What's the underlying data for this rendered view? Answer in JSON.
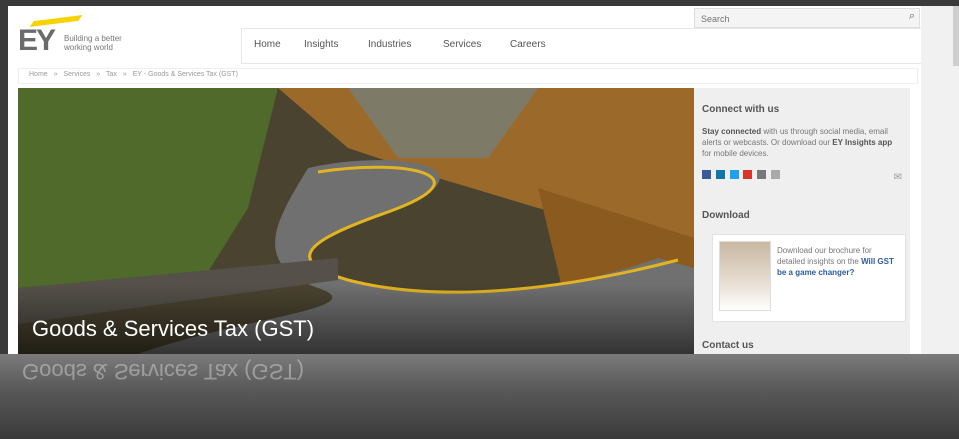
{
  "header": {
    "logo_text": "EY",
    "tagline": "Building a better working world",
    "search_placeholder": "Search"
  },
  "nav": {
    "items": [
      "Home",
      "Insights",
      "Industries",
      "Services",
      "Careers"
    ]
  },
  "breadcrumb": {
    "items": [
      "Home",
      "»",
      "Services",
      "»",
      "Tax",
      "»",
      "EY - Goods & Services Tax (GST)"
    ]
  },
  "hero": {
    "title": "Goods & Services Tax (GST)"
  },
  "sidebar": {
    "connect": {
      "title": "Connect with us",
      "text_strong": "Stay connected",
      "text": " with us through social media, email alerts or webcasts. Or download our ",
      "app": "EY Insights app",
      "text_end": " for mobile devices."
    },
    "download": {
      "title": "Download",
      "text": "Download our brochure for detailed insights on the ",
      "link": "Will GST be a game changer?"
    },
    "contact": {
      "title": "Contact us"
    }
  },
  "colors": {
    "brand_yellow": "#f5d200",
    "link_blue": "#2b5aa0"
  }
}
